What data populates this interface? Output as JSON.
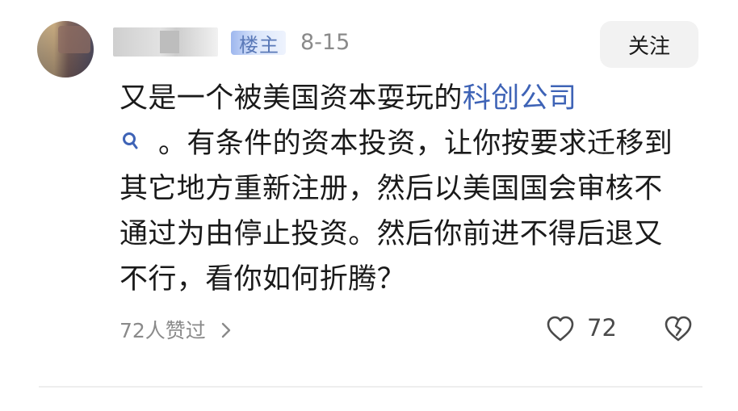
{
  "comment": {
    "op_badge": "楼主",
    "date": "8-15",
    "follow_label": "关注",
    "text_before_link": "又是一个被美国资本耍玩的",
    "link_text": "科创公司",
    "link_icon": "search-icon",
    "text_after_link": "。有条件的资本投资，让你按要求迁移到其它地方重新注册，然后以美国国会审核不通过为由停止投资。然后你前进不得后退又不行，看你如何折腾？",
    "likers_text": "72人赞过",
    "like_count": "72",
    "colors": {
      "link": "#3e63b6",
      "meta": "#8a8a8a",
      "badge_text": "#5a79b8",
      "follow_bg": "#f2f2f2"
    }
  }
}
